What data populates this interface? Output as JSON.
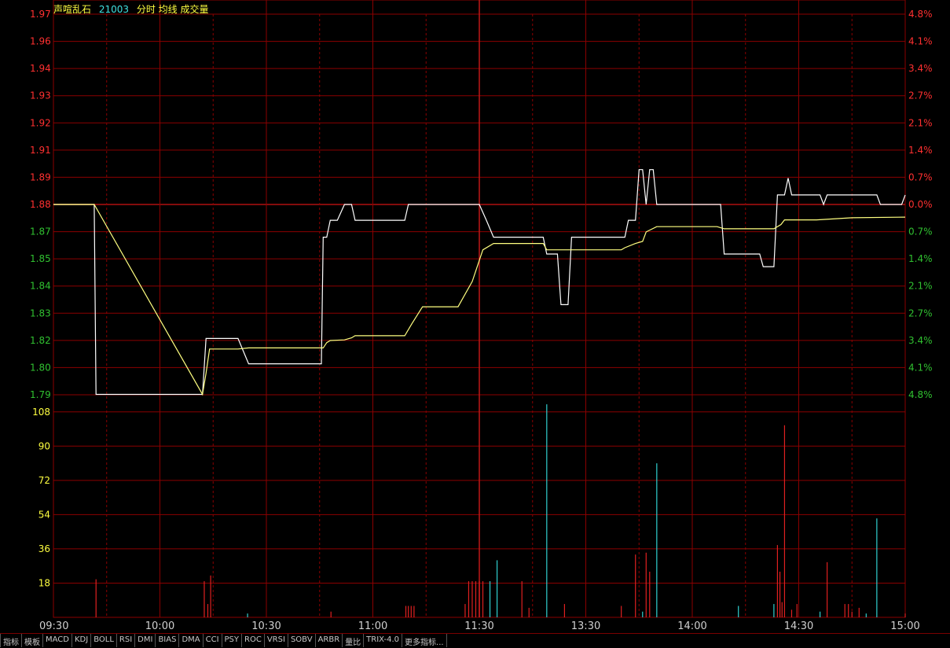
{
  "header": {
    "name": "声喧乱石",
    "code": "21003",
    "title": "分时 均线 成交量"
  },
  "tabs": [
    "指标",
    "模板",
    "MACD",
    "KDJ",
    "BOLL",
    "RSI",
    "DMI",
    "BIAS",
    "DMA",
    "CCI",
    "PSY",
    "ROC",
    "VRSI",
    "SOBV",
    "ARBR",
    "量比",
    "TRIX-4.0",
    "更多指标..."
  ],
  "colors": {
    "background": "#000000",
    "grid": "#8b0000",
    "price_line": "#ffffff",
    "avg_line": "#ffff80",
    "up_label": "#ff3030",
    "down_label": "#30c030",
    "up_bar": "#e02020",
    "down_bar": "#30d0d0",
    "volume_label": "#ffff40",
    "time_label": "#d0d0d0"
  },
  "chart_data": {
    "type": "line",
    "title": "分时 均线 成交量",
    "prev_close": 1.88,
    "price_axis": {
      "ticks": [
        "1.97",
        "1.96",
        "1.94",
        "1.93",
        "1.92",
        "1.91",
        "1.89",
        "1.88",
        "1.87",
        "1.85",
        "1.84",
        "1.83",
        "1.82",
        "1.80",
        "1.79"
      ],
      "pct_ticks": [
        "4.8%",
        "4.1%",
        "3.4%",
        "2.7%",
        "2.1%",
        "1.4%",
        "0.7%",
        "0.0%",
        "0.7%",
        "1.4%",
        "2.1%",
        "2.7%",
        "3.4%",
        "4.1%",
        "4.8%"
      ],
      "ylim": [
        1.7898,
        1.9702
      ]
    },
    "volume_axis": {
      "ticks": [
        "108",
        "90",
        "72",
        "54",
        "36",
        "18"
      ],
      "ylim": [
        0,
        117
      ]
    },
    "time_axis": {
      "labels": [
        "09:30",
        "10:00",
        "10:30",
        "11:00",
        "11:30",
        "13:30",
        "14:00",
        "14:30",
        "15:00"
      ],
      "minutes": [
        0,
        30,
        60,
        90,
        120,
        150,
        180,
        210,
        240
      ]
    },
    "series": [
      {
        "name": "分时",
        "points": [
          [
            0,
            1.88
          ],
          [
            11.5,
            1.88
          ],
          [
            12,
            1.79
          ],
          [
            42,
            1.79
          ],
          [
            43,
            1.8165
          ],
          [
            52,
            1.8165
          ],
          [
            55,
            1.8045
          ],
          [
            75.5,
            1.8045
          ],
          [
            76,
            1.8645
          ],
          [
            77,
            1.8645
          ],
          [
            78,
            1.8725
          ],
          [
            80,
            1.8725
          ],
          [
            82,
            1.88
          ],
          [
            84,
            1.88
          ],
          [
            85,
            1.8725
          ],
          [
            99,
            1.8725
          ],
          [
            100,
            1.88
          ],
          [
            120,
            1.88
          ],
          [
            122,
            1.8725
          ],
          [
            124,
            1.8645
          ],
          [
            138,
            1.8645
          ],
          [
            139,
            1.8565
          ],
          [
            142,
            1.8565
          ],
          [
            143,
            1.8325
          ],
          [
            145,
            1.8325
          ],
          [
            146,
            1.8645
          ],
          [
            161,
            1.8645
          ],
          [
            162,
            1.8725
          ],
          [
            164,
            1.8725
          ],
          [
            165,
            1.8965
          ],
          [
            166,
            1.8965
          ],
          [
            167,
            1.88
          ],
          [
            168,
            1.8965
          ],
          [
            169,
            1.8965
          ],
          [
            170,
            1.88
          ],
          [
            188,
            1.88
          ],
          [
            189,
            1.8565
          ],
          [
            199,
            1.8565
          ],
          [
            200,
            1.8505
          ],
          [
            203,
            1.8505
          ],
          [
            204,
            1.8845
          ],
          [
            206,
            1.8845
          ],
          [
            207,
            1.8925
          ],
          [
            208,
            1.8845
          ],
          [
            216,
            1.8845
          ],
          [
            217,
            1.88
          ],
          [
            218,
            1.8845
          ],
          [
            232,
            1.8845
          ],
          [
            233,
            1.88
          ],
          [
            239,
            1.88
          ],
          [
            240,
            1.8845
          ]
        ]
      },
      {
        "name": "均线",
        "points": [
          [
            0,
            1.88
          ],
          [
            11.5,
            1.88
          ],
          [
            42,
            1.79
          ],
          [
            43,
            1.8
          ],
          [
            44,
            1.8115
          ],
          [
            52,
            1.8115
          ],
          [
            55,
            1.812
          ],
          [
            76,
            1.812
          ],
          [
            77,
            1.8145
          ],
          [
            78,
            1.8155
          ],
          [
            82,
            1.8158
          ],
          [
            84,
            1.8168
          ],
          [
            85,
            1.8178
          ],
          [
            99,
            1.8178
          ],
          [
            101,
            1.8235
          ],
          [
            104,
            1.8315
          ],
          [
            114,
            1.8315
          ],
          [
            118,
            1.8435
          ],
          [
            121,
            1.8585
          ],
          [
            124,
            1.8615
          ],
          [
            138,
            1.8615
          ],
          [
            139,
            1.8585
          ],
          [
            160,
            1.8585
          ],
          [
            161,
            1.8595
          ],
          [
            164,
            1.8615
          ],
          [
            166,
            1.8625
          ],
          [
            167,
            1.867
          ],
          [
            170,
            1.8695
          ],
          [
            187,
            1.8695
          ],
          [
            189,
            1.8685
          ],
          [
            203,
            1.8685
          ],
          [
            205,
            1.8705
          ],
          [
            206,
            1.8727
          ],
          [
            215,
            1.8727
          ],
          [
            225,
            1.8737
          ],
          [
            240,
            1.874
          ]
        ]
      }
    ],
    "volume_bars": [
      [
        12,
        20,
        "up"
      ],
      [
        42.5,
        19,
        "up"
      ],
      [
        43.5,
        7,
        "up"
      ],
      [
        44.3,
        22,
        "up"
      ],
      [
        54.7,
        2,
        "down"
      ],
      [
        78.2,
        3,
        "up"
      ],
      [
        99.3,
        6,
        "up"
      ],
      [
        100,
        6,
        "up"
      ],
      [
        100.8,
        6,
        "up"
      ],
      [
        101.6,
        6,
        "up"
      ],
      [
        116,
        7,
        "up"
      ],
      [
        117,
        19,
        "up"
      ],
      [
        118,
        19,
        "up"
      ],
      [
        119,
        19,
        "up"
      ],
      [
        120,
        19,
        "up"
      ],
      [
        121,
        19,
        "up"
      ],
      [
        123,
        19,
        "down"
      ],
      [
        125,
        30,
        "down"
      ],
      [
        132,
        19,
        "up"
      ],
      [
        134,
        5,
        "up"
      ],
      [
        139,
        112,
        "down"
      ],
      [
        144,
        7,
        "up"
      ],
      [
        160,
        6,
        "up"
      ],
      [
        164,
        33,
        "up"
      ],
      [
        166,
        3,
        "down"
      ],
      [
        167,
        34,
        "up"
      ],
      [
        168,
        24,
        "up"
      ],
      [
        170,
        81,
        "down"
      ],
      [
        193,
        6,
        "down"
      ],
      [
        203,
        7,
        "down"
      ],
      [
        204,
        38,
        "up"
      ],
      [
        204.7,
        24,
        "up"
      ],
      [
        205.3,
        8,
        "up"
      ],
      [
        206,
        101,
        "up"
      ],
      [
        208,
        4,
        "up"
      ],
      [
        209.5,
        7,
        "up"
      ],
      [
        216,
        3,
        "down"
      ],
      [
        218,
        29,
        "up"
      ],
      [
        223,
        7,
        "up"
      ],
      [
        224,
        7,
        "up"
      ],
      [
        225,
        3,
        "up"
      ],
      [
        227,
        5,
        "up"
      ],
      [
        229,
        2,
        "down"
      ],
      [
        232,
        52,
        "down"
      ],
      [
        240,
        2,
        "up"
      ]
    ]
  }
}
